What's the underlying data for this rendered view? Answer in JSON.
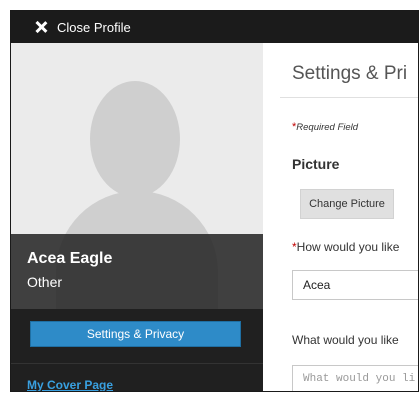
{
  "topbar": {
    "close_label": "Close Profile"
  },
  "profile": {
    "name": "Acea Eagle",
    "type": "Other"
  },
  "sidebar": {
    "settings_button_label": "Settings & Privacy",
    "cover_link_label": "My Cover Page"
  },
  "main": {
    "title": "Settings & Pri",
    "required_marker": "*",
    "required_text": "Required Field",
    "picture_heading": "Picture",
    "change_picture_label": "Change Picture",
    "question1_marker": "*",
    "question1_text": "How would you like",
    "name_value": "Acea",
    "question2_text": "What would you like",
    "textarea_placeholder": "What would you li"
  },
  "colors": {
    "topbar": "#1b1b1b",
    "accent_button": "#2e8bc8",
    "link": "#39a0e0",
    "required_star": "#c00000"
  },
  "icons": {
    "close": "close-icon",
    "avatar": "default-avatar-silhouette"
  }
}
